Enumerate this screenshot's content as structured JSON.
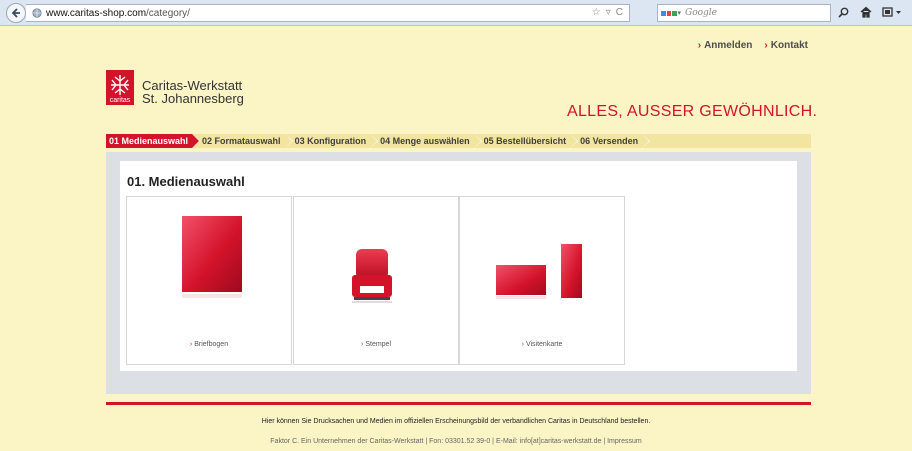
{
  "browser": {
    "url_domain": "www.caritas-shop.com",
    "url_path": "/category/",
    "search_placeholder": "Google"
  },
  "topnav": {
    "login": "Anmelden",
    "contact": "Kontakt"
  },
  "logo": {
    "mark_text": "caritas",
    "line1": "Caritas-Werkstatt",
    "line2": "St. Johannesberg"
  },
  "tagline": "ALLES, AUSSER GEWÖHNLICH.",
  "steps": [
    {
      "label": "01 Medienauswahl"
    },
    {
      "label": "02 Formatauswahl"
    },
    {
      "label": "03 Konfiguration"
    },
    {
      "label": "04 Menge auswählen"
    },
    {
      "label": "05 Bestellübersicht"
    },
    {
      "label": "06 Versenden"
    }
  ],
  "main": {
    "title": "01. Medienauswahl",
    "products": [
      {
        "label": "Briefbogen"
      },
      {
        "label": "Stempel"
      },
      {
        "label": "Visitenkarte"
      }
    ]
  },
  "footer": {
    "line1": "Hier können Sie Drucksachen und Medien im offiziellen Erscheinungsbild der verbandlichen Caritas in Deutschland bestellen.",
    "line2": "Faktor C. Ein Unternehmen der Caritas-Werkstatt | Fon: 03301.52 39-0 | E-Mail: info[at]caritas-werkstatt.de | Impressum"
  },
  "colors": {
    "brand_red": "#d3132a",
    "page_bg": "#fbf4c5",
    "steps_bg": "#f1e59f"
  }
}
